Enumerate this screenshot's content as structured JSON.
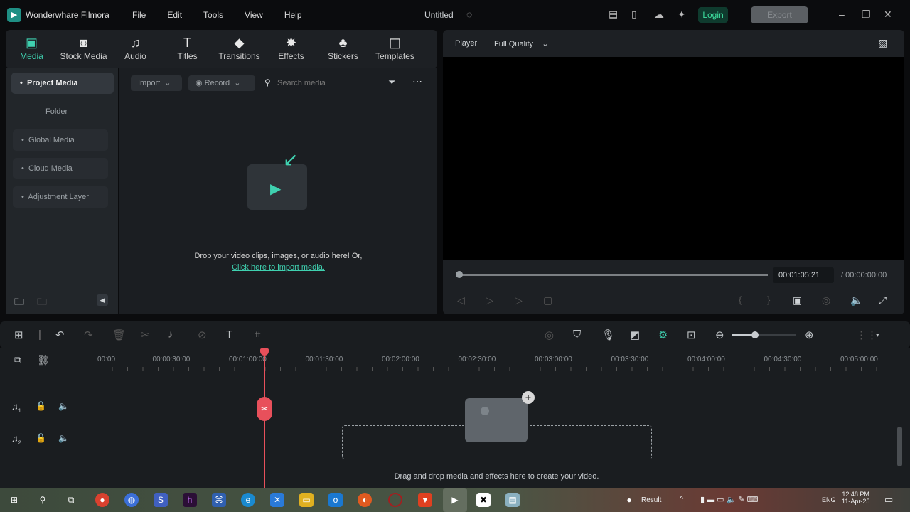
{
  "app": {
    "name": "Wonderwhare Filmora",
    "doc_title": "Untitled",
    "menu": [
      "File",
      "Edit",
      "Tools",
      "View",
      "Help"
    ],
    "login": "Login",
    "export": "Export"
  },
  "tabs": [
    {
      "label": "Media",
      "icon": "media-icon"
    },
    {
      "label": "Stock Media",
      "icon": "stock-media-icon"
    },
    {
      "label": "Audio",
      "icon": "music-note-icon"
    },
    {
      "label": "Titles",
      "icon": "text-t-icon"
    },
    {
      "label": "Transitions",
      "icon": "transitions-icon"
    },
    {
      "label": "Effects",
      "icon": "effects-icon"
    },
    {
      "label": "Stickers",
      "icon": "stickers-icon"
    },
    {
      "label": "Templates",
      "icon": "templates-icon"
    }
  ],
  "sidebar": {
    "items": [
      "Project Media",
      "Folder",
      "Global Media",
      "Cloud Media",
      "Adjustment Layer"
    ]
  },
  "media": {
    "import": "Import",
    "record": "Record",
    "search_placeholder": "Search media",
    "drop_text": "Drop your video clips, images, or audio here! Or,",
    "import_link": "Click here to import media."
  },
  "player": {
    "label": "Player",
    "quality": "Full Quality",
    "current_time": "00:01:05:21",
    "total_time": "/ 00:00:00:00",
    "progress": 0
  },
  "timeline": {
    "ruler": [
      "00:00",
      "00:00:30:00",
      "00:01:00:00",
      "00:01:30:00",
      "00:02:00:00",
      "00:02:30:00",
      "00:03:00:00",
      "00:03:30:00",
      "00:04:00:00",
      "00:04:30:00",
      "00:05:00:00"
    ],
    "tracks": [
      "1",
      "2"
    ],
    "drop_text": "Drag and drop media and effects here to create your video.",
    "zoom_level": 0.35
  },
  "taskbar": {
    "weather": "Result",
    "lang": "ENG",
    "time": "12:48 PM",
    "date": "11-Apr-25"
  },
  "colors": {
    "accent": "#3fd1b0",
    "playhead": "#e8505b"
  }
}
